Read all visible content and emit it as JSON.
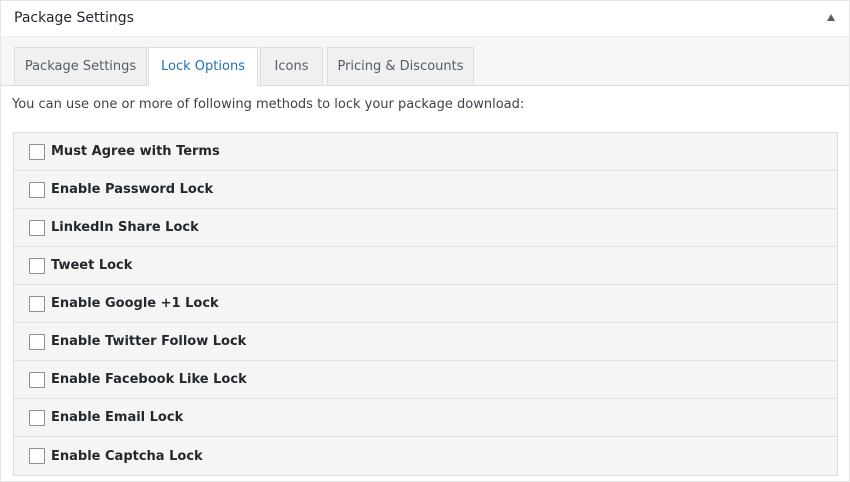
{
  "panel": {
    "title": "Package Settings",
    "toggle_icon": "triangle-up-icon"
  },
  "tabs": [
    {
      "label": "Package Settings",
      "active": false
    },
    {
      "label": "Lock Options",
      "active": true
    },
    {
      "label": "Icons",
      "active": false
    },
    {
      "label": "Pricing & Discounts",
      "active": false
    }
  ],
  "intro_text": "You can use one or more of following methods to lock your package download:",
  "lock_options": [
    {
      "label": "Must Agree with Terms",
      "checked": false
    },
    {
      "label": "Enable Password Lock",
      "checked": false
    },
    {
      "label": "LinkedIn Share Lock",
      "checked": false
    },
    {
      "label": "Tweet Lock",
      "checked": false
    },
    {
      "label": "Enable Google +1 Lock",
      "checked": false
    },
    {
      "label": "Enable Twitter Follow Lock",
      "checked": false
    },
    {
      "label": "Enable Facebook Like Lock",
      "checked": false
    },
    {
      "label": "Enable Email Lock",
      "checked": false
    },
    {
      "label": "Enable Captcha Lock",
      "checked": false
    }
  ],
  "colors": {
    "active_tab_text": "#2271b1",
    "tab_text": "#555d66",
    "row_background": "#f5f5f5"
  }
}
